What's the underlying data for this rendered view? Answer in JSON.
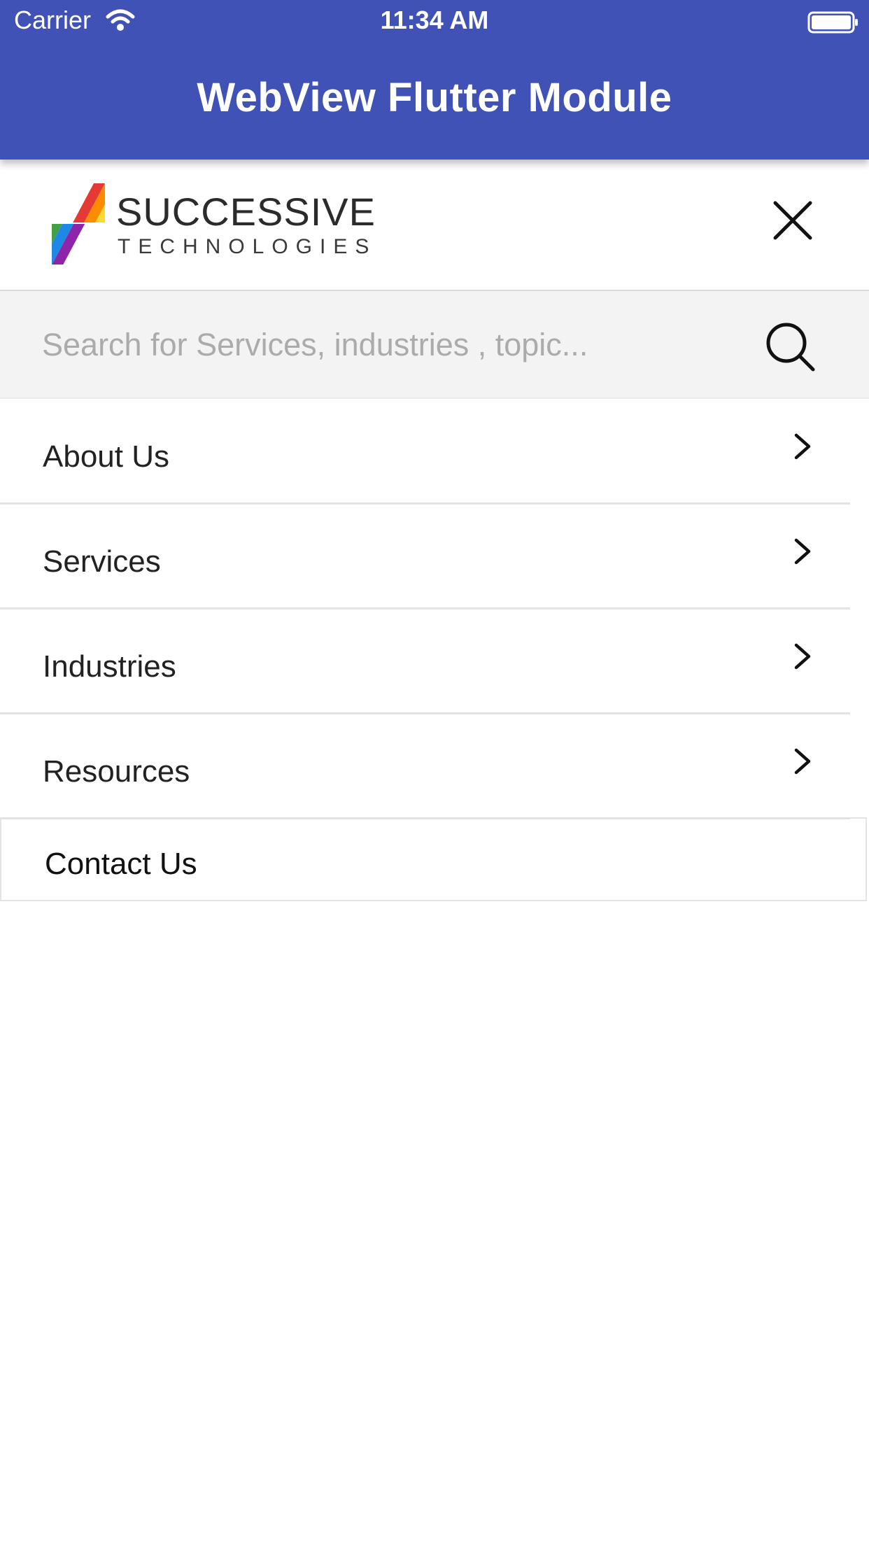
{
  "status_bar": {
    "carrier": "Carrier",
    "time": "11:34 AM",
    "icons": [
      "wifi-icon",
      "battery-icon"
    ]
  },
  "app_bar": {
    "title": "WebView Flutter Module",
    "color": "#4052b5"
  },
  "header": {
    "logo_line1": "SUCCESSIVE",
    "logo_line2": "TECHNOLOGIES",
    "close_icon": "close-icon"
  },
  "search": {
    "placeholder": "Search for Services, industries , topic...",
    "value": "",
    "icon": "search-icon"
  },
  "menu": {
    "items": [
      {
        "label": "About Us",
        "icon": "chevron-right-icon"
      },
      {
        "label": "Services",
        "icon": "chevron-right-icon"
      },
      {
        "label": "Industries",
        "icon": "chevron-right-icon"
      },
      {
        "label": "Resources",
        "icon": "chevron-right-icon"
      }
    ],
    "contact_label": "Contact Us"
  }
}
